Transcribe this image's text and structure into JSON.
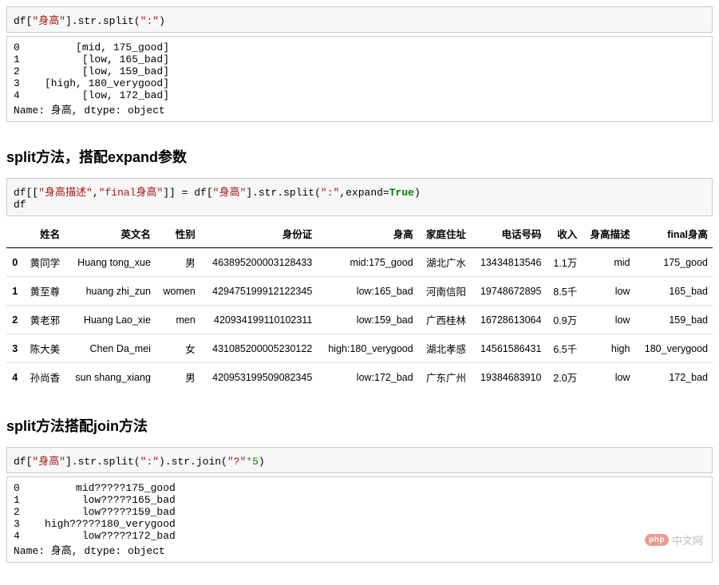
{
  "code1": {
    "df": "df",
    "col": "\"身高\"",
    "str": ".str.split(",
    "arg": "\":\"",
    "tail": ")"
  },
  "output1": "0         [mid, 175_good]\n1          [low, 165_bad]\n2          [low, 159_bad]\n3    [high, 180_verygood]\n4          [low, 172_bad]\nName: 身高, dtype: object",
  "heading1": "split方法，搭配expand参数",
  "code2": {
    "line1_a": "df[[",
    "line1_b": "\"身高描述\"",
    "line1_c": ",",
    "line1_d": "\"final身高\"",
    "line1_e": "]] = df[",
    "line1_f": "\"身高\"",
    "line1_g": "].str.split(",
    "line1_h": "\":\"",
    "line1_i": ",expand=",
    "line1_j": "True",
    "line1_k": ")",
    "line2": "df"
  },
  "table": {
    "columns": [
      "",
      "姓名",
      "英文名",
      "性别",
      "身份证",
      "身高",
      "家庭住址",
      "电话号码",
      "收入",
      "身高描述",
      "final身高"
    ],
    "rows": [
      [
        "0",
        "黄同学",
        "Huang tong_xue",
        "男",
        "463895200003128433",
        "mid:175_good",
        "湖北广水",
        "13434813546",
        "1.1万",
        "mid",
        "175_good"
      ],
      [
        "1",
        "黄至尊",
        "huang zhi_zun",
        "women",
        "429475199912122345",
        "low:165_bad",
        "河南信阳",
        "19748672895",
        "8.5千",
        "low",
        "165_bad"
      ],
      [
        "2",
        "黄老邪",
        "Huang Lao_xie",
        "men",
        "420934199110102311",
        "low:159_bad",
        "广西桂林",
        "16728613064",
        "0.9万",
        "low",
        "159_bad"
      ],
      [
        "3",
        "陈大美",
        "Chen Da_mei",
        "女",
        "431085200005230122",
        "high:180_verygood",
        "湖北孝感",
        "14561586431",
        "6.5千",
        "high",
        "180_verygood"
      ],
      [
        "4",
        "孙尚香",
        "sun shang_xiang",
        "男",
        "420953199509082345",
        "low:172_bad",
        "广东广州",
        "19384683910",
        "2.0万",
        "low",
        "172_bad"
      ]
    ]
  },
  "heading2": "split方法搭配join方法",
  "code3": {
    "a": "df[",
    "b": "\"身高\"",
    "c": "].str.split(",
    "d": "\":\"",
    "e": ").str.join(",
    "f": "\"?\"",
    "g": "*",
    "h": "5",
    "i": ")"
  },
  "output3": "0         mid?????175_good\n1          low?????165_bad\n2          low?????159_bad\n3    high?????180_verygood\n4          low?????172_bad\nName: 身高, dtype: object",
  "watermark": {
    "logo": "php",
    "text": "中文网"
  }
}
